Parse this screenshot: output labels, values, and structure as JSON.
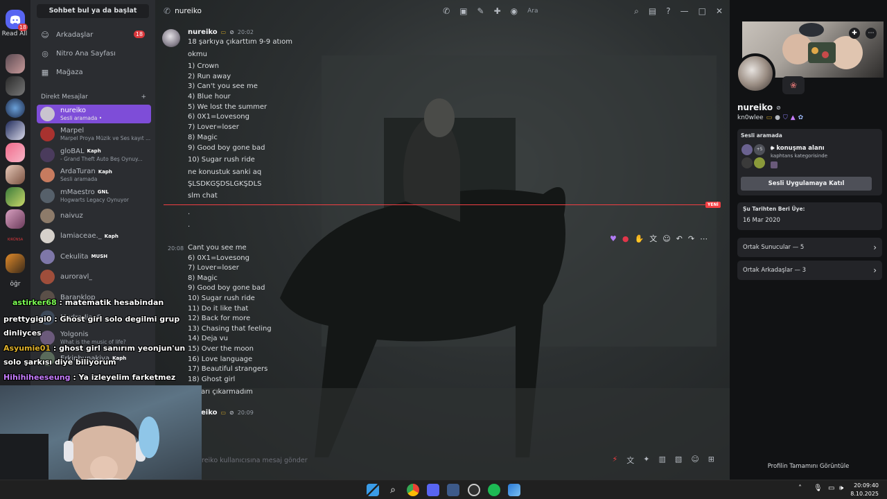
{
  "rail": {
    "badge": "18",
    "read_all": "Read All",
    "folder_label": "öğr",
    "small_label": "KIRÜNSA"
  },
  "sidebar": {
    "search_label": "Sohbet bul ya da başlat",
    "nav": [
      {
        "label": "Arkadaşlar",
        "icon": "friends-icon",
        "badge": "18"
      },
      {
        "label": "Nitro Ana Sayfası",
        "icon": "nitro-icon"
      },
      {
        "label": "Mağaza",
        "icon": "shop-icon"
      }
    ],
    "dm_header": "Direkt Mesajlar",
    "dm_add": "+",
    "dms": [
      {
        "name": "nureiko",
        "status": "Sesli aramada •",
        "active": true,
        "color": "#c9c4cf"
      },
      {
        "name": "Marpel",
        "status": "Marpel Proya Müzik ve Ses kayıt ...",
        "color": "#a8322f"
      },
      {
        "name": "gloBAL",
        "tag": "Kaph",
        "status": "- Grand Theft Auto Beş Oynuy...",
        "color": "#4a3b5c"
      },
      {
        "name": "ArdaTuran",
        "tag": "Kaph",
        "status": "Sesli aramada",
        "color": "#c77b5f"
      },
      {
        "name": "mMaestro",
        "tag": "GNL",
        "status": "Hogwarts Legacy Oynuyor",
        "color": "#56606a"
      },
      {
        "name": "naivuz",
        "status": "",
        "color": "#8d7b6a"
      },
      {
        "name": "lamiaceae._",
        "tag": "Kaph",
        "status": "",
        "color": "#d6d1cb"
      },
      {
        "name": "Cekulita",
        "tag": "MUSH",
        "status": "",
        "color": "#7e77a8"
      },
      {
        "name": "auroravl_",
        "status": "",
        "color": "#9f4e3b"
      },
      {
        "name": "Baranklop",
        "status": "",
        "color": "#5a4f48"
      },
      {
        "name": "ModradiaaS",
        "status": "",
        "color": "#3e4a5a"
      },
      {
        "name": "Yolgonis",
        "status": "What is the music of life?",
        "color": "#6b5a7b"
      },
      {
        "name": "Erkinbunakiva",
        "tag": "Kaph",
        "status": "",
        "color": "#5a6b5b"
      }
    ]
  },
  "chat": {
    "channel_name": "nureiko",
    "search_placeholder": "Ara",
    "first_author": "nureiko",
    "first_time": "20:02",
    "lines_a": [
      "18 şarkıya çıkarttım 9-9 atıom",
      "okmu",
      "1) Crown",
      "2) Run away",
      "3) Can't you see me",
      "4) Blue hour",
      "5) We lost the summer",
      "6) 0X1=Lovesong",
      "7) Lover=loser",
      "8) Magic",
      "9) Good boy gone bad",
      "10) Sugar rush ride",
      "ne konustuk sanki aq",
      "ŞLSDKGŞDSLGKŞDLS",
      "slm chat"
    ],
    "new_label": "YENİ",
    "dots": [
      ".",
      "."
    ],
    "second_time": "20:08",
    "lines_b": [
      "Cant you see me",
      "6) 0X1=Lovesong",
      "7) Lover=loser",
      "8) Magic",
      "9) Good boy gone bad",
      "10) Sugar rush ride",
      "11) Do it like that",
      "12) Back for more",
      "13) Chasing that feeling",
      "14) Deja vu",
      "15) Over the moon",
      "16) Love language",
      "17) Beautiful strangers",
      "18) Ghost girl",
      "arı çıkarmadım"
    ],
    "third_author": "eiko",
    "third_time": "20:09",
    "composer_placeholder": "reiko kullanıcısına mesaj gönder"
  },
  "profile": {
    "name": "nureiko",
    "username": "kn0wlee",
    "voice_title": "Sesli aramada",
    "voice_count": "+5",
    "voice_channel": "konuşma alanı",
    "voice_category": "kaphtans kategorisinde",
    "join_button": "Sesli Uygulamaya Katıl",
    "member_since_label": "Şu Tarihten Beri Üye:",
    "member_since": "16 Mar 2020",
    "mutual_servers": "Ortak Sunucular — 5",
    "mutual_friends": "Ortak Arkadaşlar — 3",
    "full_profile": "Profilin Tamamını Görüntüle"
  },
  "stream_chat": [
    {
      "user": "astirker68",
      "text": " : matematik hesabindan",
      "color": "#7cfc54"
    },
    {
      "user": "prettygigi0",
      "text": " : Ghost girl solo degilmi grup",
      "color": "#ffffff",
      "cont": "dinliyces"
    },
    {
      "user": "Asyumie01",
      "text": " : ghost girl sanırım yeonjun'un",
      "color": "#e0b22b",
      "cont": "solo şarkısı diye biliyorum"
    },
    {
      "user": "Hihihiheeseung",
      "text": " : Ya izleyelim farketmez",
      "color": "#c77dff"
    }
  ],
  "taskbar": {
    "time": "20:09:40",
    "date": "8.10.2025"
  },
  "colors": {
    "accent": "#7e4dd8",
    "danger": "#da373c",
    "bg": "#313338"
  }
}
